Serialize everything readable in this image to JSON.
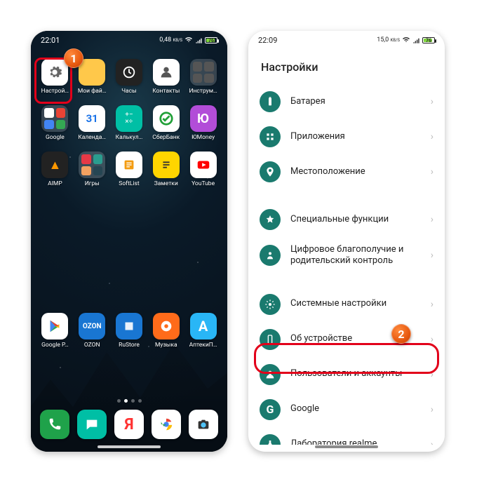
{
  "statusbar": {
    "time": "22:09",
    "net_rate": "15,0",
    "net_unit": "KB/S",
    "battery_pct": 76,
    "battery_label": "76"
  },
  "left_status": {
    "time": "22:01",
    "net_rate": "0,48",
    "net_unit": "KB/S",
    "battery_pct": 76,
    "battery_label": "76"
  },
  "callouts": {
    "one": "1",
    "two": "2"
  },
  "home": {
    "apps": [
      {
        "id": "settings",
        "label": "Настрой…",
        "icon": "gear"
      },
      {
        "id": "files",
        "label": "Мои фай…",
        "icon": "folder"
      },
      {
        "id": "clock",
        "label": "Часы",
        "icon": "clock"
      },
      {
        "id": "contacts",
        "label": "Контакты",
        "icon": "contacts"
      },
      {
        "id": "tools",
        "label": "Инструм…",
        "icon": "tools-folder"
      },
      {
        "id": "google",
        "label": "Google",
        "icon": "google-folder"
      },
      {
        "id": "calendar",
        "label": "Календа…",
        "icon": "calendar"
      },
      {
        "id": "calc",
        "label": "Калькул…",
        "icon": "calc"
      },
      {
        "id": "sber",
        "label": "СберБанк",
        "icon": "sber"
      },
      {
        "id": "yoomoney",
        "label": "ЮMoney",
        "icon": "yoomoney"
      },
      {
        "id": "aimp",
        "label": "AIMP",
        "icon": "aimp"
      },
      {
        "id": "games",
        "label": "Игры",
        "icon": "games-folder"
      },
      {
        "id": "softlist",
        "label": "SoftList",
        "icon": "softlist"
      },
      {
        "id": "notes",
        "label": "Заметки",
        "icon": "notes"
      },
      {
        "id": "youtube",
        "label": "YouTube",
        "icon": "youtube"
      }
    ],
    "favorites": [
      {
        "id": "play",
        "label": "Google P…",
        "icon": "play"
      },
      {
        "id": "ozon",
        "label": "OZON",
        "icon": "ozon"
      },
      {
        "id": "rustore",
        "label": "RuStore",
        "icon": "rustore"
      },
      {
        "id": "music",
        "label": "Музыка",
        "icon": "music"
      },
      {
        "id": "apteki",
        "label": "АптекиП…",
        "icon": "apteki"
      }
    ],
    "dock": [
      {
        "id": "phone",
        "icon": "phone"
      },
      {
        "id": "messages",
        "icon": "messages"
      },
      {
        "id": "yandex",
        "icon": "yandex"
      },
      {
        "id": "chrome",
        "icon": "chrome"
      },
      {
        "id": "camera",
        "icon": "camera"
      }
    ]
  },
  "settings": {
    "title": "Настройки",
    "sections": [
      [
        {
          "id": "battery",
          "label": "Батарея",
          "icon": "battery"
        },
        {
          "id": "apps",
          "label": "Приложения",
          "icon": "apps"
        },
        {
          "id": "location",
          "label": "Местоположение",
          "icon": "location"
        }
      ],
      [
        {
          "id": "special",
          "label": "Специальные функции",
          "icon": "special"
        },
        {
          "id": "wellbeing",
          "label": "Цифровое благополучие и родительский контроль",
          "icon": "wellbeing"
        }
      ],
      [
        {
          "id": "system",
          "label": "Системные настройки",
          "icon": "system"
        },
        {
          "id": "about",
          "label": "Об устройстве",
          "icon": "about"
        },
        {
          "id": "users",
          "label": "Пользователи и аккаунты",
          "icon": "users"
        },
        {
          "id": "google",
          "label": "Google",
          "icon": "google"
        },
        {
          "id": "lab",
          "label": "Лаборатория realme",
          "icon": "lab"
        }
      ]
    ]
  }
}
